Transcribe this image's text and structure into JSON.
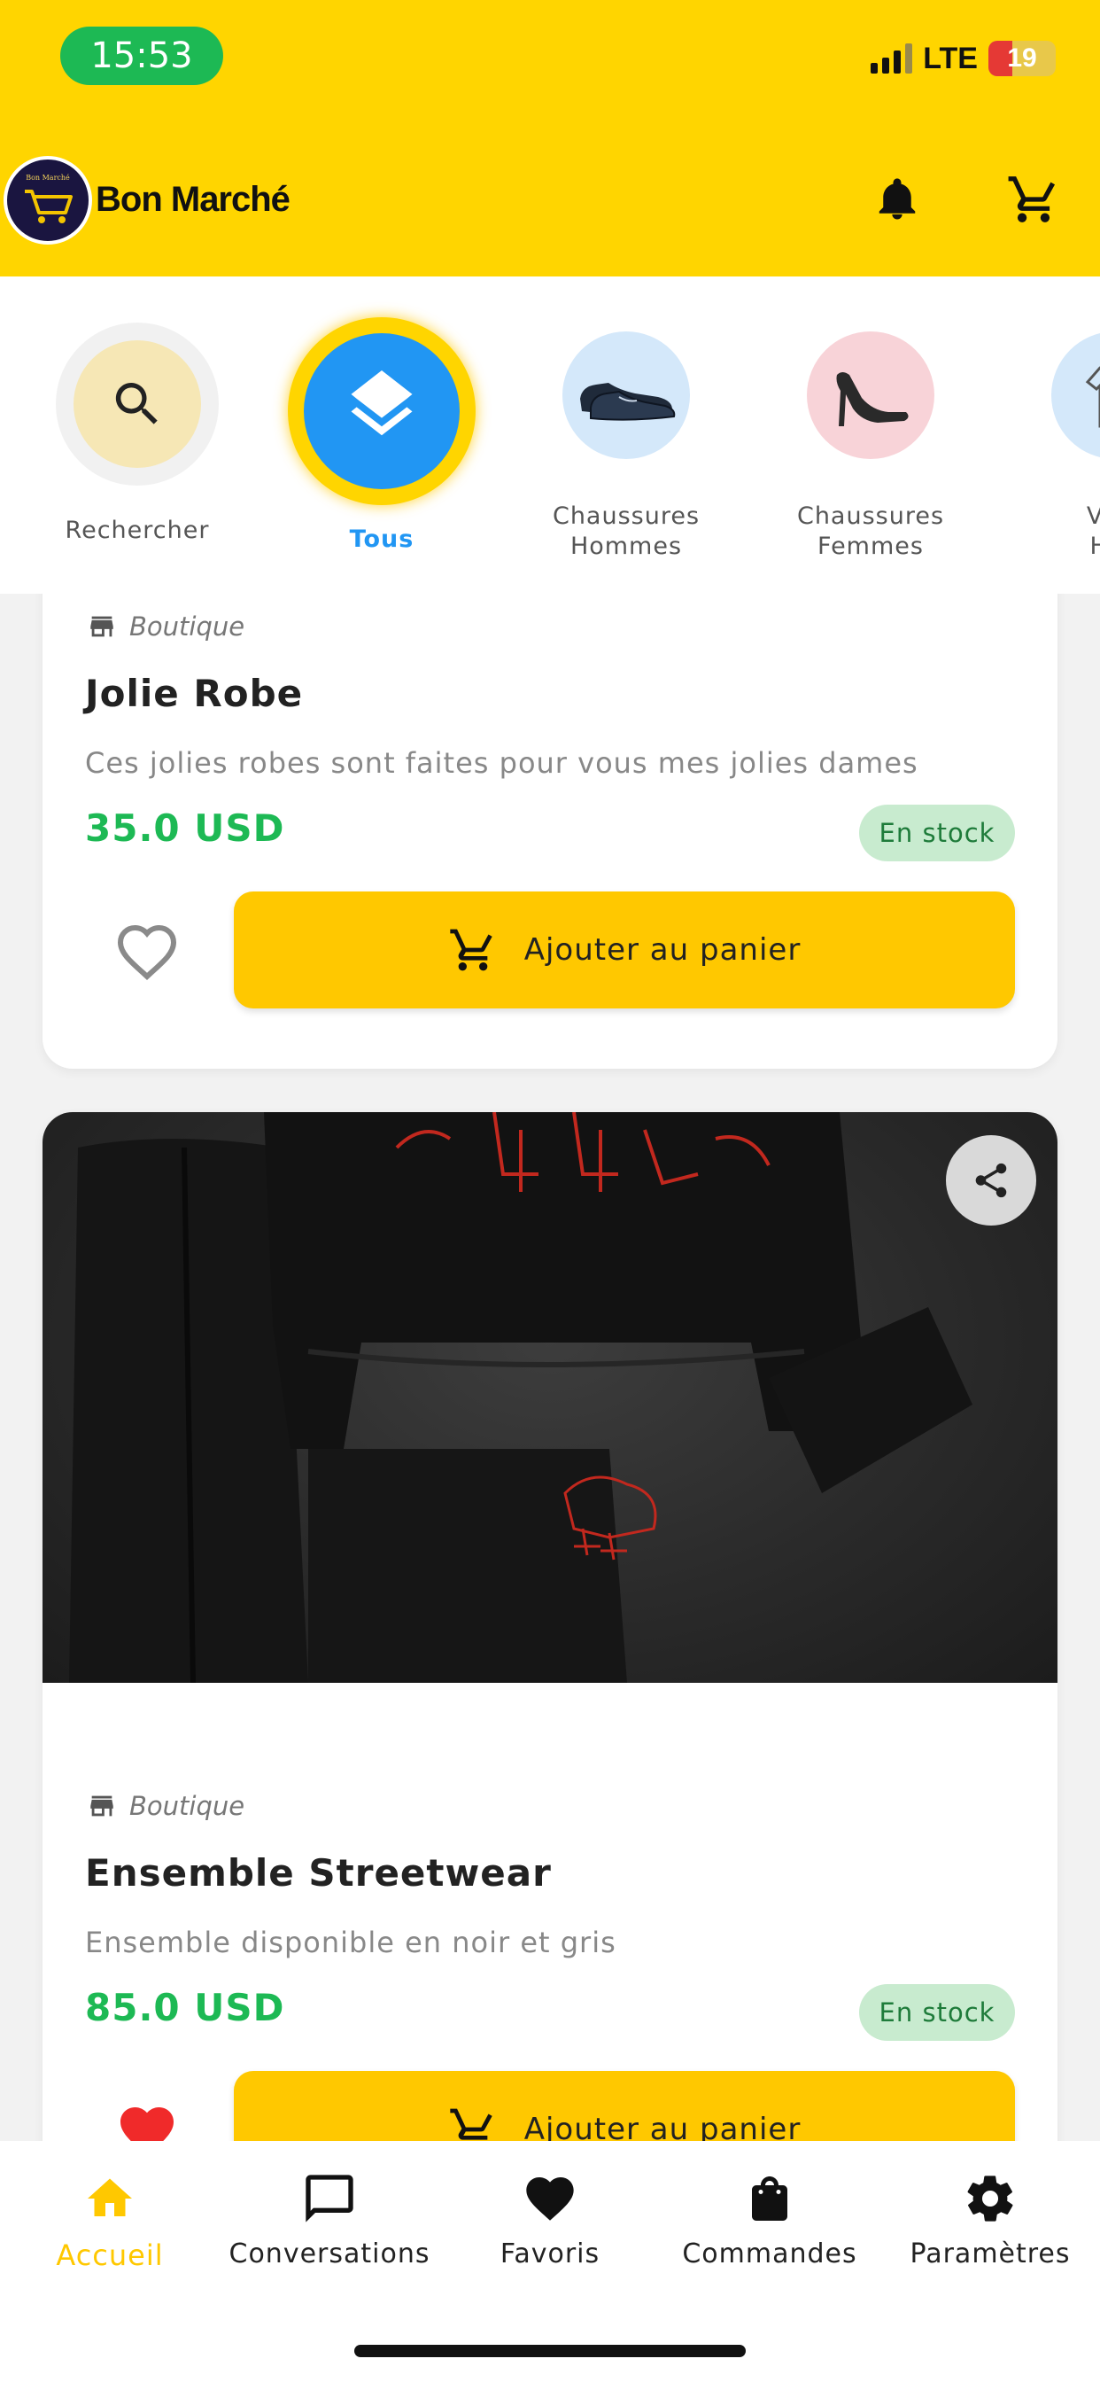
{
  "status_bar": {
    "time": "15:53",
    "network": "LTE",
    "battery": "19"
  },
  "header": {
    "brand": "Bon Marché",
    "logo_text": "Bon Marché",
    "icons": [
      "bell-icon",
      "cart-icon"
    ]
  },
  "categories": [
    {
      "label": "Rechercher",
      "icon": "search-icon"
    },
    {
      "label": "Tous",
      "icon": "layers-icon",
      "active": true
    },
    {
      "label": "Chaussures Hommes",
      "icon": "men-shoe-icon"
    },
    {
      "label": "Chaussures Femmes",
      "icon": "heel-icon"
    },
    {
      "label": "Vête Hon",
      "icon": "clothing-icon"
    }
  ],
  "products": [
    {
      "shop": "Boutique",
      "title": "Jolie Robe",
      "description": "Ces jolies robes sont faites pour vous mes jolies dames",
      "price": "35.0 USD",
      "stock": "En stock",
      "favorite": false,
      "cta": "Ajouter au panier"
    },
    {
      "shop": "Boutique",
      "title": "Ensemble Streetwear",
      "description": "Ensemble disponible en noir et gris",
      "price": "85.0 USD",
      "stock": "En stock",
      "favorite": true,
      "cta": "Ajouter au panier"
    }
  ],
  "bottom_nav": [
    {
      "label": "Accueil",
      "icon": "home-icon",
      "active": true
    },
    {
      "label": "Conversations",
      "icon": "chat-icon"
    },
    {
      "label": "Favoris",
      "icon": "heart-icon"
    },
    {
      "label": "Commandes",
      "icon": "bag-icon"
    },
    {
      "label": "Paramètres",
      "icon": "gear-icon"
    }
  ],
  "colors": {
    "primary": "#FFD500",
    "button": "#FFC800",
    "price": "#1DB954",
    "accent": "#2196F3",
    "favorite": "#F02A2A"
  }
}
